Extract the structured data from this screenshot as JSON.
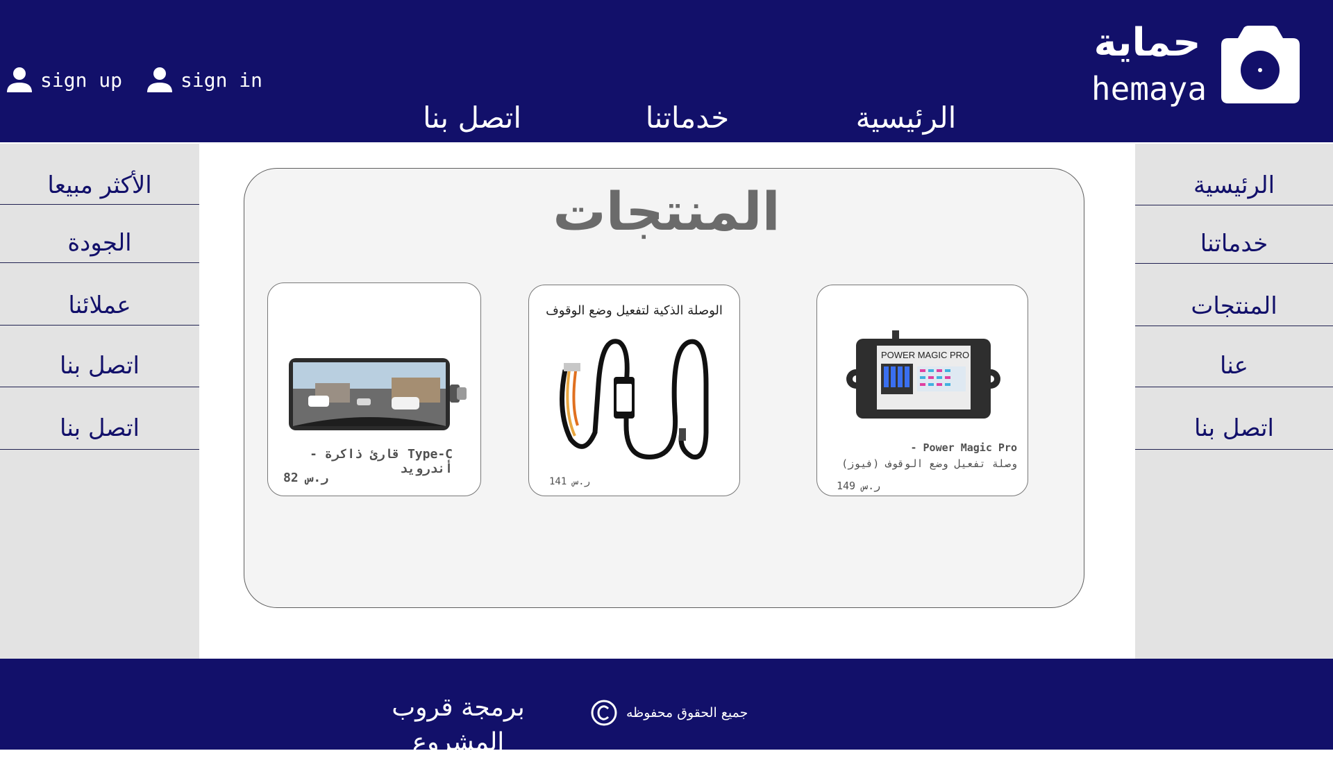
{
  "brand": {
    "name_ar": "حماية",
    "name_en": "hemaya"
  },
  "auth": {
    "signup": "sign up",
    "signin": "sign in"
  },
  "top_nav": [
    "الرئيسية",
    "خدماتنا",
    "اتصل بنا"
  ],
  "right_sidebar": [
    "الرئيسية",
    "خدماتنا",
    "المنتجات",
    "عنا",
    "اتصل بنا"
  ],
  "left_sidebar": [
    "الأكثر مبيعا",
    "الجودة",
    "عملائنا",
    "اتصل بنا",
    "اتصل بنا"
  ],
  "products_title": "المنتجات",
  "products": [
    {
      "name": "Type-C قارئ ذاكرة - أندرويد",
      "price": "ر.س 82"
    },
    {
      "name": "الوصلة الذكية لتفعيل وضع الوقوف",
      "price": "ر.س 141"
    },
    {
      "name_line1": "Power Magic Pro -",
      "name_line2": "وصلة تفعيل وضع الوقوف (فيوز)",
      "price": "ر.س 149",
      "device_label": "POWER MAGIC PRO"
    }
  ],
  "footer": {
    "credit": "برمجة قروب المشروع",
    "copyright": "جميع الحقوق محفوظه"
  },
  "colors": {
    "navy": "#12106a",
    "sidebar_bg": "#e3e3e3",
    "panel_bg": "#f4f4f4",
    "title_gray": "#6b6b6b"
  }
}
